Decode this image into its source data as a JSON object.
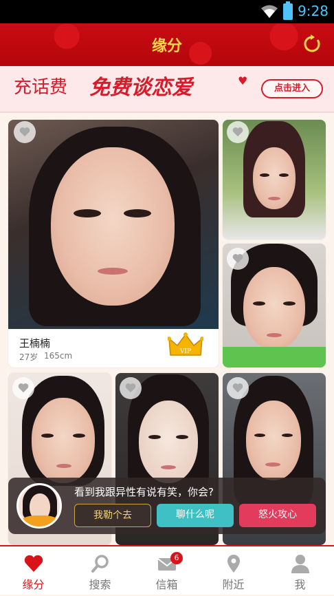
{
  "status_bar": {
    "time": "9:28"
  },
  "header": {
    "title": "缘分"
  },
  "banner": {
    "prefix": "充话费",
    "slogan": "免费谈恋爱",
    "cta": "点击进入"
  },
  "featured": {
    "name": "王楠楠",
    "age": "27岁",
    "height": "165cm",
    "badge": "VIP"
  },
  "prompt": {
    "question": "看到我跟异性有说有笑，你会?",
    "options": [
      "我勒个去",
      "聊什么呢",
      "怒火攻心"
    ]
  },
  "nav": {
    "items": [
      {
        "label": "缘分",
        "icon": "heart-icon"
      },
      {
        "label": "搜索",
        "icon": "search-icon"
      },
      {
        "label": "信箱",
        "icon": "mail-icon",
        "badge": "6"
      },
      {
        "label": "附近",
        "icon": "location-pin-icon"
      },
      {
        "label": "我",
        "icon": "person-icon"
      }
    ]
  },
  "colors": {
    "brand_red": "#d8141a",
    "title_gold": "#ffd64a",
    "accent_teal": "#3fc0c5",
    "accent_pink": "#e33b5b"
  }
}
